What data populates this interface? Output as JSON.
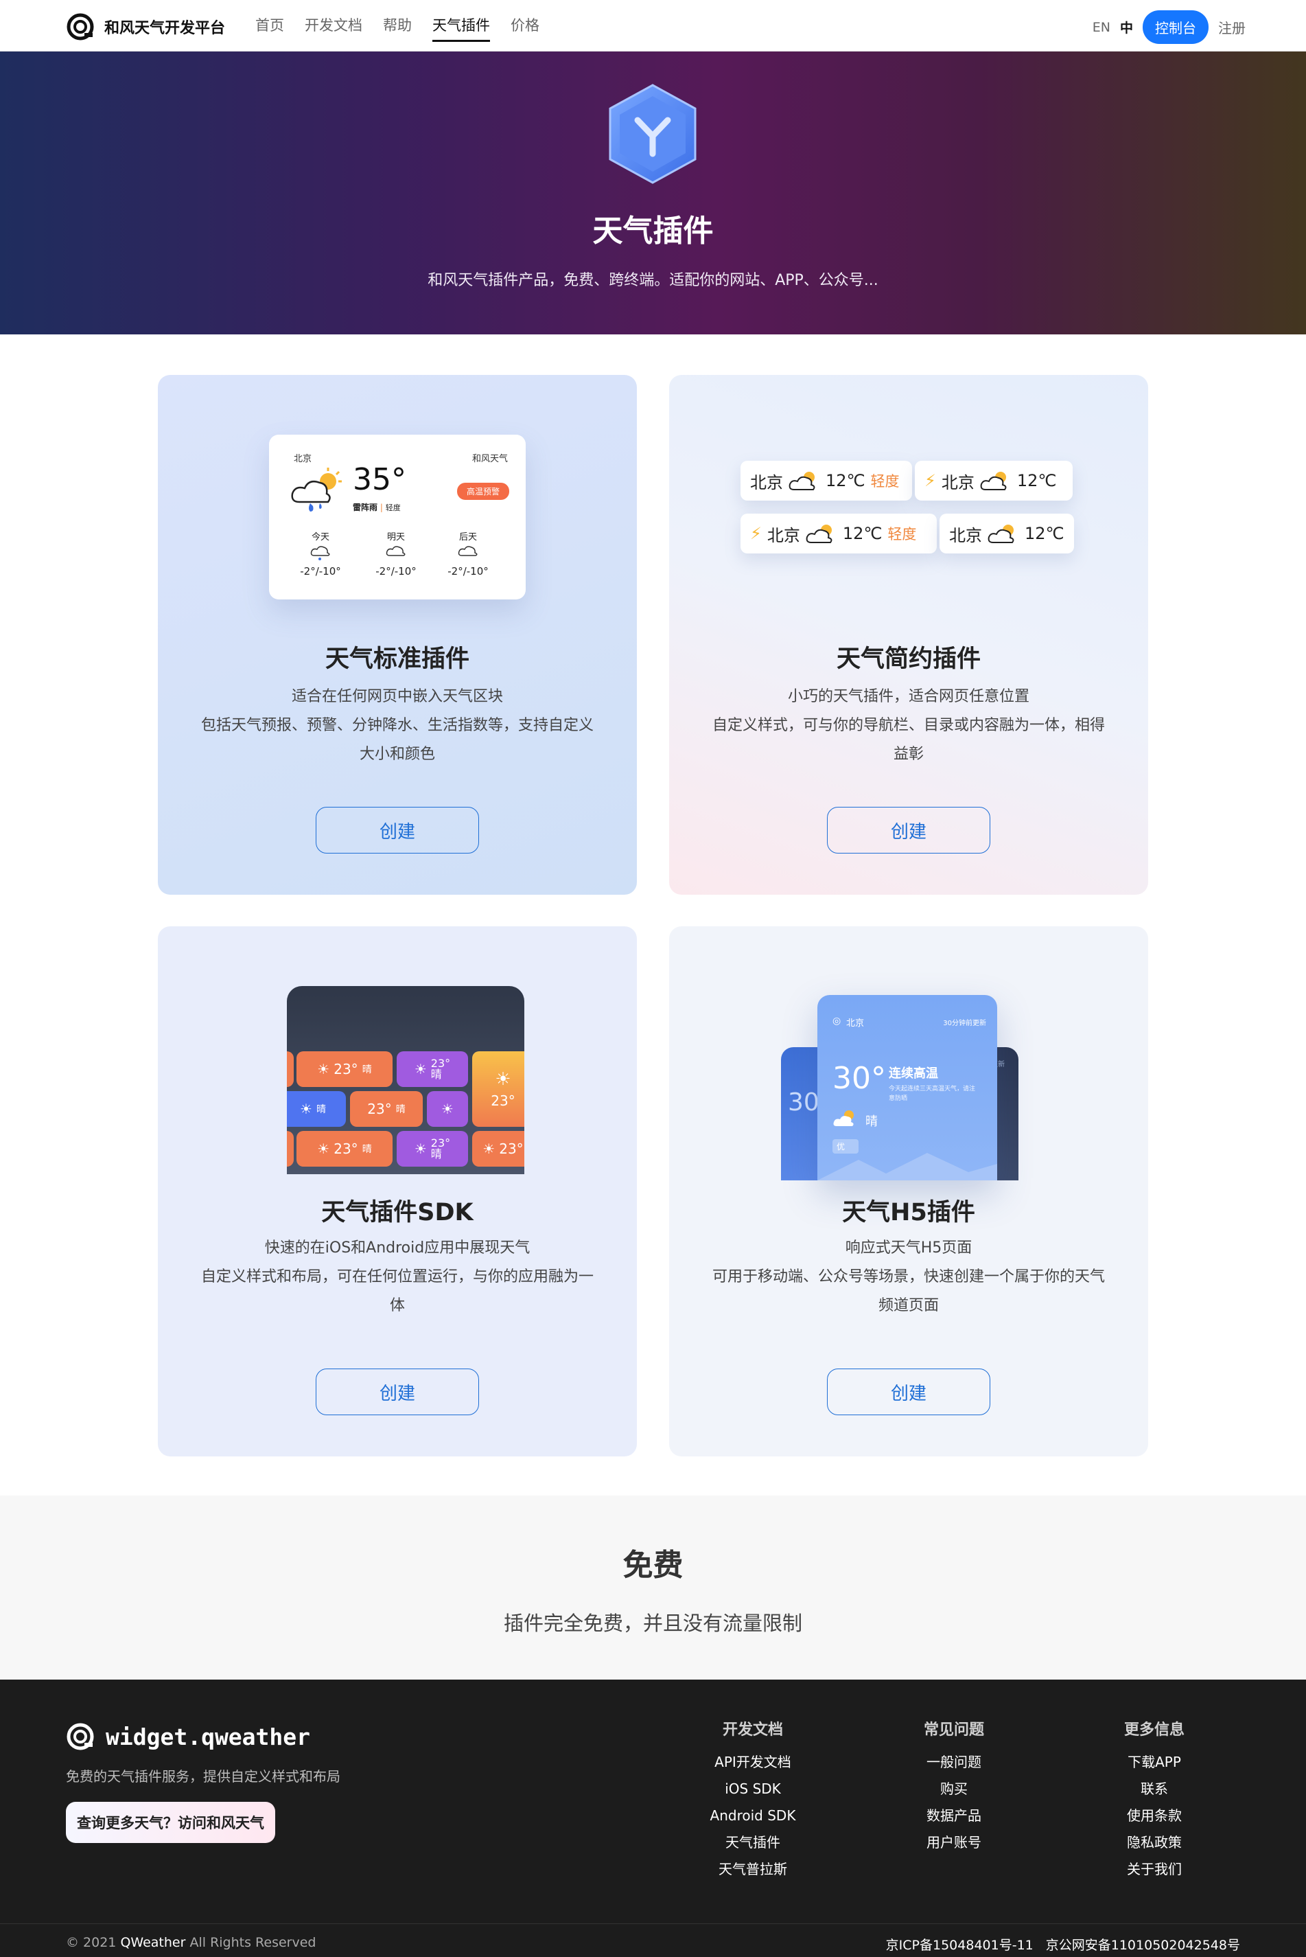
{
  "header": {
    "brand": "和风天气开发平台",
    "nav": [
      "首页",
      "开发文档",
      "帮助",
      "天气插件",
      "价格"
    ],
    "lang_en": "EN",
    "lang_zh": "中",
    "console": "控制台",
    "register": "注册"
  },
  "hero": {
    "title": "天气插件",
    "subtitle": "和风天气插件产品，免费、跨终端。适配你的网站、APP、公众号..."
  },
  "cards": [
    {
      "title": "天气标准插件",
      "desc": [
        "适合在任何网页中嵌入天气区块",
        "包括天气预报、预警、分钟降水、生活指数等，支持自定义大小和颜色"
      ],
      "button": "创建",
      "preview": {
        "city": "北京",
        "brand": "和风天气",
        "temp": "35°",
        "condition": "雷阵雨",
        "level": "轻度",
        "alert": "高温预警",
        "days": [
          {
            "label": "今天",
            "range": "-2°/-10°"
          },
          {
            "label": "明天",
            "range": "-2°/-10°"
          },
          {
            "label": "后天",
            "range": "-2°/-10°"
          }
        ]
      }
    },
    {
      "title": "天气简约插件",
      "desc": [
        "小巧的天气插件，适合网页任意位置",
        "自定义样式，可与你的导航栏、目录或内容融为一体，相得益彰"
      ],
      "button": "创建",
      "preview": {
        "chips": [
          {
            "city": "北京",
            "temp": "12℃",
            "level": "轻度",
            "bolt": false
          },
          {
            "city": "北京",
            "temp": "12℃",
            "level": "",
            "bolt": true
          },
          {
            "city": "北京",
            "temp": "12℃",
            "level": "轻度",
            "bolt": true
          },
          {
            "city": "北京",
            "temp": "12℃",
            "level": "",
            "bolt": false
          }
        ]
      }
    },
    {
      "title": "天气插件SDK",
      "desc": [
        "快速的在iOS和Android应用中展现天气",
        "自定义样式和布局，可在任何位置运行，与你的应用融为一体"
      ],
      "button": "创建",
      "preview": {
        "temp": "23°",
        "cond": "晴"
      }
    },
    {
      "title": "天气H5插件",
      "desc": [
        "响应式天气H5页面",
        "可用于移动端、公众号等场景，快速创建一个属于你的天气频道页面"
      ],
      "button": "创建",
      "preview": {
        "city": "北京",
        "updated": "30分钟前更新",
        "temp": "30°",
        "headline": "连续高温",
        "note": "今天起连续三天高温天气，请注意防晒",
        "cond": "晴",
        "aq": "优",
        "back_temp": "30",
        "back_updated": "分钟前更新"
      }
    }
  ],
  "free": {
    "title": "免费",
    "subtitle": "插件完全免费，并且没有流量限制"
  },
  "footer": {
    "logo": "widget.qweather",
    "desc": "免费的天气插件服务，提供自定义样式和布局",
    "cta": "查询更多天气？访问和风天气",
    "columns": [
      {
        "title": "开发文档",
        "links": [
          "API开发文档",
          "iOS SDK",
          "Android SDK",
          "天气插件",
          "天气普拉斯"
        ]
      },
      {
        "title": "常见问题",
        "links": [
          "一般问题",
          "购买",
          "数据产品",
          "用户账号"
        ]
      },
      {
        "title": "更多信息",
        "links": [
          "下载APP",
          "联系",
          "使用条款",
          "隐私政策",
          "关于我们"
        ]
      }
    ],
    "copyright_prefix": "© 2021",
    "copyright_brand": "QWeather",
    "copyright_suffix": "All Rights Reserved",
    "icp": "京ICP备15048401号-11",
    "police": "京公网安备11010502042548号"
  },
  "colors": {
    "accent": "#1677ff",
    "link": "#1f6fd6",
    "alert": "#f46b45",
    "level": "#f0883e"
  }
}
